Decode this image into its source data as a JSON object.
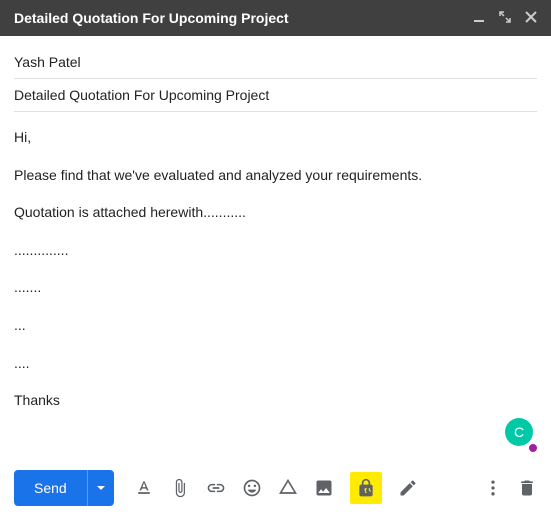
{
  "header": {
    "title": "Detailed Quotation For Upcoming Project"
  },
  "recipient": "Yash Patel",
  "subject": "Detailed Quotation For Upcoming Project",
  "body": {
    "greeting": "Hi,",
    "line1": "Please find that we've evaluated and analyzed your requirements.",
    "line2": "Quotation is attached herewith...........",
    "line3": "..............",
    "line4": ".......",
    "line5": "...",
    "line6": "....",
    "signoff": "Thanks"
  },
  "toolbar": {
    "send_label": "Send"
  },
  "avatar": {
    "letter": "C"
  }
}
